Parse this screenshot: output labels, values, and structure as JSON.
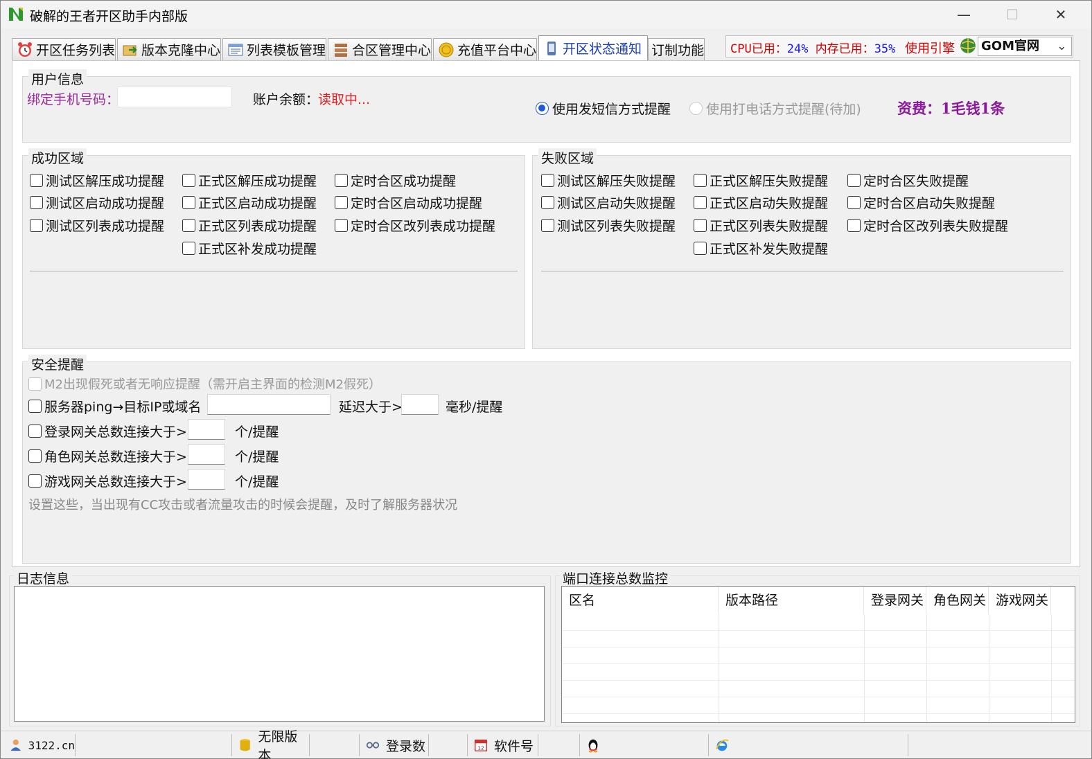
{
  "window": {
    "title": "破解的王者开区助手内部版",
    "minimize": "—",
    "maximize": "☐",
    "close": "✕"
  },
  "tabs": [
    {
      "label": "开区任务列表",
      "icon": "alarm-clock-icon"
    },
    {
      "label": "版本克隆中心",
      "icon": "clone-folder-icon"
    },
    {
      "label": "列表模板管理",
      "icon": "list-template-icon"
    },
    {
      "label": "合区管理中心",
      "icon": "merge-server-icon"
    },
    {
      "label": "充值平台中心",
      "icon": "coin-icon"
    },
    {
      "label": "开区状态通知",
      "icon": "phone-icon",
      "active": true
    },
    {
      "label": "订制功能"
    }
  ],
  "sysinfo": {
    "cpu_label": "CPU已用：",
    "cpu_value": "24%",
    "mem_label": "内存已用：",
    "mem_value": "35%",
    "engine_label": "使用引擎",
    "engine_value": "GOM官网"
  },
  "user_info": {
    "title": "用户信息",
    "phone_label": "绑定手机号码：",
    "phone_value": "",
    "balance_label": "账户余额：",
    "balance_value": "读取中...",
    "sms_option": "使用发短信方式提醒",
    "call_option": "使用打电话方式提醒(待加)",
    "fee": "资费：1毛钱1条"
  },
  "success": {
    "title": "成功区域",
    "col1": [
      "测试区解压成功提醒",
      "测试区启动成功提醒",
      "测试区列表成功提醒"
    ],
    "col2": [
      "正式区解压成功提醒",
      "正式区启动成功提醒",
      "正式区列表成功提醒",
      "正式区补发成功提醒"
    ],
    "col3": [
      "定时合区成功提醒",
      "定时合区启动成功提醒",
      "定时合区改列表成功提醒"
    ]
  },
  "failure": {
    "title": "失败区域",
    "col1": [
      "测试区解压失败提醒",
      "测试区启动失败提醒",
      "测试区列表失败提醒"
    ],
    "col2": [
      "正式区解压失败提醒",
      "正式区启动失败提醒",
      "正式区列表失败提醒",
      "正式区补发失败提醒"
    ],
    "col3": [
      "定时合区失败提醒",
      "定时合区启动失败提醒",
      "定时合区改列表失败提醒"
    ]
  },
  "security": {
    "title": "安全提醒",
    "m2_check": "M2出现假死或者无响应提醒（需开启主界面的检测M2假死）",
    "ping_check": "服务器ping→目标IP或域名",
    "delay_label": "延迟大于>",
    "ms_label": "毫秒/提醒",
    "login_check": "登录网关总数连接大于>",
    "role_check": "角色网关总数连接大于>",
    "game_check": "游戏网关总数连接大于>",
    "per_label": "个/提醒",
    "hint": "设置这些，当出现有CC攻击或者流量攻击的时候会提醒，及时了解服务器状况"
  },
  "log": {
    "title": "日志信息"
  },
  "port_monitor": {
    "title": "端口连接总数监控",
    "columns": [
      "区名",
      "版本路径",
      "登录网关",
      "角色网关",
      "游戏网关"
    ]
  },
  "statusbar": {
    "site": "3122.cn",
    "version": "无限版本",
    "logins": "登录数",
    "software": "软件号"
  }
}
